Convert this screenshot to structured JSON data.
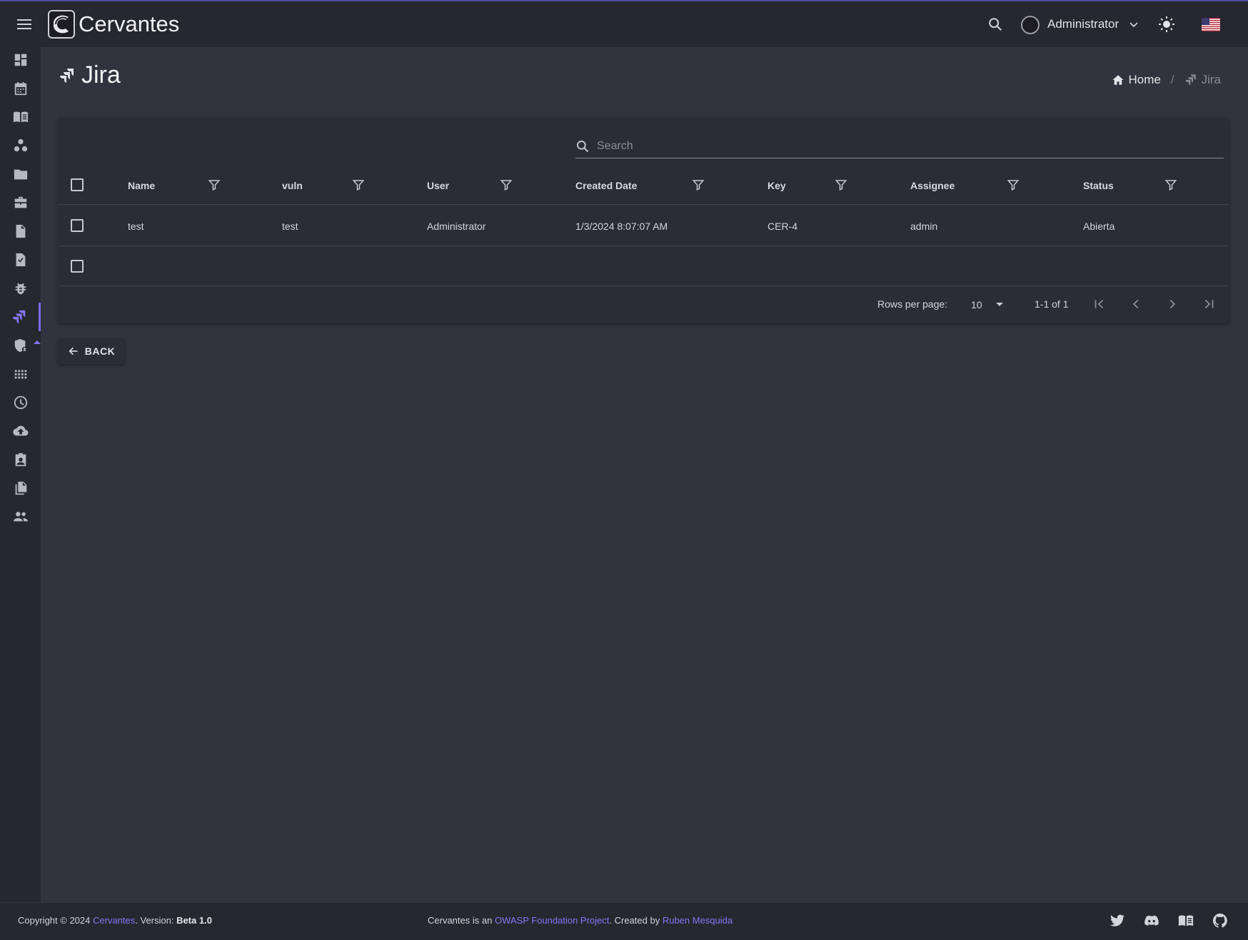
{
  "app": {
    "title": "Cervantes"
  },
  "header": {
    "user_name": "Administrator",
    "icons": [
      "menu-icon",
      "search-icon",
      "chevron-down-icon",
      "sun-icon",
      "us-flag-icon"
    ]
  },
  "sidebar": {
    "items": [
      {
        "icon": "dashboard-icon"
      },
      {
        "icon": "calendar-icon"
      },
      {
        "icon": "book-icon"
      },
      {
        "icon": "workspaces-icon"
      },
      {
        "icon": "folder-icon"
      },
      {
        "icon": "briefcase-icon"
      },
      {
        "icon": "document-icon"
      },
      {
        "icon": "task-check-icon"
      },
      {
        "icon": "bug-icon"
      },
      {
        "icon": "jira-icon",
        "active": true
      },
      {
        "icon": "security-icon"
      },
      {
        "icon": "apps-grid-icon"
      },
      {
        "icon": "clock-icon"
      },
      {
        "icon": "cloud-upload-icon"
      },
      {
        "icon": "contact-card-icon"
      },
      {
        "icon": "copy-icon"
      },
      {
        "icon": "people-icon"
      }
    ]
  },
  "page": {
    "title": "Jira",
    "breadcrumb": {
      "home": "Home",
      "current": "Jira"
    }
  },
  "table": {
    "search_placeholder": "Search",
    "columns": [
      "Name",
      "vuln",
      "User",
      "Created Date",
      "Key",
      "Assignee",
      "Status"
    ],
    "rows": [
      {
        "name": "test",
        "vuln": "test",
        "user": "Administrator",
        "created_date": "1/3/2024 8:07:07 AM",
        "key": "CER-4",
        "assignee": "admin",
        "status": "Abierta"
      }
    ],
    "pagination": {
      "rows_per_page_label": "Rows per page:",
      "rows_per_page": "10",
      "range": "1-1 of 1"
    }
  },
  "actions": {
    "back_label": "BACK"
  },
  "footer": {
    "copyright": "Copyright © 2024",
    "brand_link": "Cervantes",
    "version_prefix": ". Version:",
    "version": "Beta 1.0",
    "project_prefix": "Cervantes is an",
    "project_link": "OWASP Foundation Project",
    "created_by": ". Created by",
    "author_link": "Ruben Mesquida",
    "social_icons": [
      "twitter-icon",
      "discord-icon",
      "docs-book-icon",
      "github-icon"
    ]
  },
  "colors": {
    "accent": "#8677f5",
    "background": "#32333e",
    "surface": "#2b2c35",
    "bar": "#26272f"
  }
}
